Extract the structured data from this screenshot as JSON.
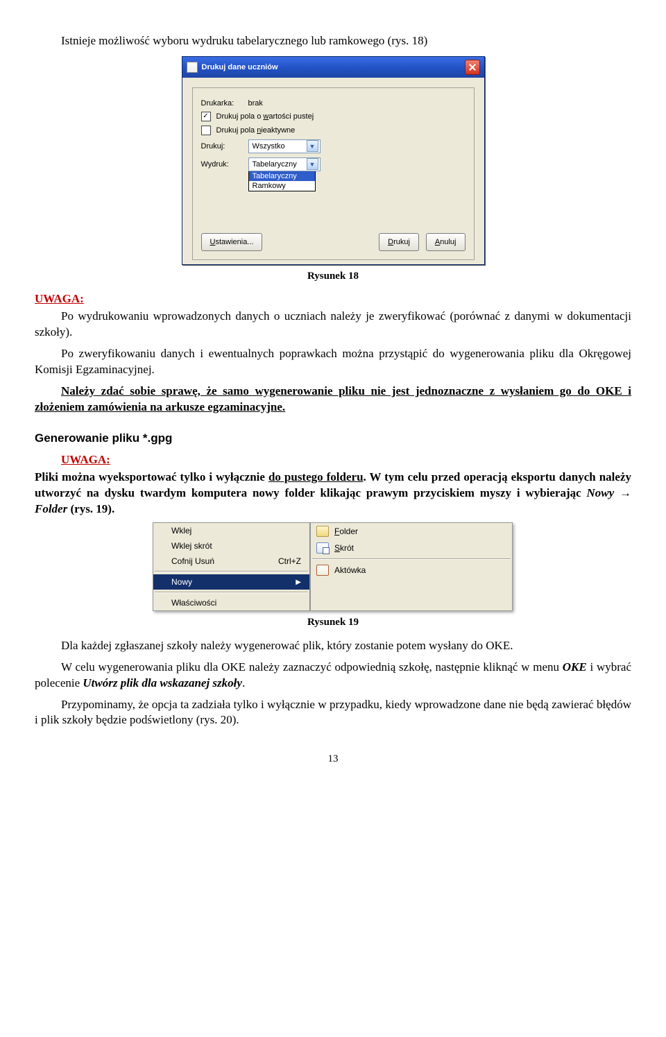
{
  "para_intro": "Istnieje możliwość wyboru wydruku tabelarycznego lub ramkowego (rys. 18)",
  "dialog1": {
    "title": "Drukuj dane uczniów",
    "printer_label": "Drukarka:",
    "printer_value": "brak",
    "cb1_label_pre": "Drukuj pola o ",
    "cb1_label_accel": "w",
    "cb1_label_post": "artości pustej",
    "cb2_label_pre": "Drukuj pola ",
    "cb2_label_accel": "n",
    "cb2_label_post": "ieaktywne",
    "drukuj_label": "Drukuj:",
    "drukuj_value": "Wszystko",
    "wydruk_label": "Wydruk:",
    "wydruk_value": "Tabelaryczny",
    "opt1": "Tabelaryczny",
    "opt2": "Ramkowy",
    "btn_settings_accel": "U",
    "btn_settings_rest": "stawienia...",
    "btn_print_accel": "D",
    "btn_print_rest": "rukuj",
    "btn_cancel_accel": "A",
    "btn_cancel_rest": "nuluj"
  },
  "fig18": "Rysunek 18",
  "uwaga1_label": "UWAGA:",
  "uwaga1_text": "Po wydrukowaniu wprowadzonych danych o uczniach należy je zweryfikować (porównać z danymi w dokumentacji szkoły).",
  "para2": "Po zweryfikowaniu danych i ewentualnych poprawkach można przystąpić do wygenerowania pliku dla Okręgowej Komisji Egzaminacyjnej.",
  "para3": "Należy zdać sobie sprawę, że samo wygenerowanie pliku nie jest jednoznaczne z wysłaniem go do OKE i złożeniem zamówienia na arkusze egzaminacyjne.",
  "section_title": "Generowanie pliku *.gpg",
  "uwaga2_label": "UWAGA:",
  "para4_a": "Pliki można wyeksportować tylko i wyłącznie ",
  "para4_b": "do pustego folderu",
  "para4_c": ". W tym celu przed operacją eksportu danych należy utworzyć na dysku twardym komputera nowy folder klikając prawym przyciskiem myszy i wybierając ",
  "para4_d": "Nowy → Folder",
  "para4_e": " (rys. 19).",
  "menu": {
    "wklej": "Wklej",
    "wklej_skrot": "Wklej skrót",
    "cofnij": "Cofnij Usuń",
    "cofnij_short": "Ctrl+Z",
    "nowy": "Nowy",
    "wlasciwosci": "Właściwości",
    "sub_folder_accel": "F",
    "sub_folder_rest": "older",
    "sub_skrot_accel": "S",
    "sub_skrot_rest": "krót",
    "sub_akt": "Aktówka"
  },
  "fig19": "Rysunek 19",
  "para5": "Dla każdej zgłaszanej szkoły należy wygenerować plik, który zostanie potem wysłany do OKE.",
  "para6_a": "W celu wygenerowania pliku dla OKE należy zaznaczyć odpowiednią szkołę, następnie kliknąć w menu ",
  "para6_b": "OKE",
  "para6_c": " i wybrać polecenie ",
  "para6_d": "Utwórz plik dla wskazanej szkoły",
  "para6_e": ".",
  "para7": "Przypominamy, że opcja ta zadziała tylko i wyłącznie w przypadku, kiedy wprowadzone dane nie będą zawierać błędów i plik szkoły będzie podświetlony (rys. 20).",
  "pagenum": "13"
}
